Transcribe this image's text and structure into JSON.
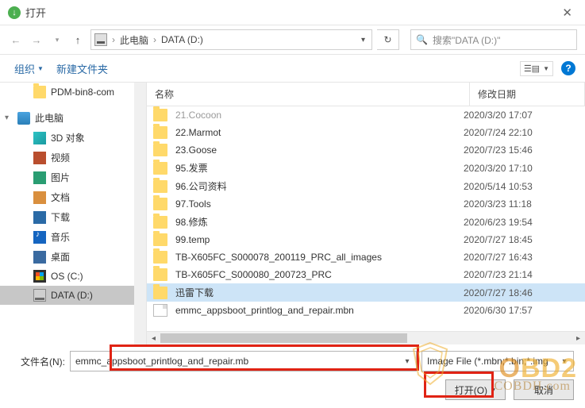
{
  "window": {
    "title": "打开"
  },
  "address": {
    "loc1": "此电脑",
    "loc2": "DATA (D:)"
  },
  "search": {
    "placeholder": "搜索\"DATA (D:)\""
  },
  "cmdbar": {
    "organize": "组织",
    "newfolder": "新建文件夹"
  },
  "tree": [
    {
      "icon": "folder",
      "label": "PDM-bin8-com",
      "indent": 2
    },
    {
      "spacer": true
    },
    {
      "icon": "pc",
      "label": "此电脑",
      "indent": 1,
      "caret": true
    },
    {
      "icon": "cube",
      "label": "3D 对象",
      "indent": 2
    },
    {
      "icon": "video",
      "label": "视频",
      "indent": 2
    },
    {
      "icon": "pic",
      "label": "图片",
      "indent": 2
    },
    {
      "icon": "doc",
      "label": "文档",
      "indent": 2
    },
    {
      "icon": "dl",
      "label": "下载",
      "indent": 2
    },
    {
      "icon": "music",
      "label": "音乐",
      "indent": 2
    },
    {
      "icon": "desk",
      "label": "桌面",
      "indent": 2
    },
    {
      "icon": "win",
      "label": "OS (C:)",
      "indent": 2
    },
    {
      "icon": "disk",
      "label": "DATA (D:)",
      "indent": 2,
      "selected": true
    }
  ],
  "columns": {
    "name": "名称",
    "date": "修改日期"
  },
  "files": [
    {
      "icon": "folder",
      "name": "21.Cocoon",
      "date": "2020/3/20 17:07",
      "faded": true
    },
    {
      "icon": "folder",
      "name": "22.Marmot",
      "date": "2020/7/24 22:10"
    },
    {
      "icon": "folder",
      "name": "23.Goose",
      "date": "2020/7/23 15:46"
    },
    {
      "icon": "folder",
      "name": "95.发票",
      "date": "2020/3/20 17:10"
    },
    {
      "icon": "folder",
      "name": "96.公司资料",
      "date": "2020/5/14 10:53"
    },
    {
      "icon": "folder",
      "name": "97.Tools",
      "date": "2020/3/23 11:18"
    },
    {
      "icon": "folder",
      "name": "98.修炼",
      "date": "2020/6/23 19:54"
    },
    {
      "icon": "folder",
      "name": "99.temp",
      "date": "2020/7/27 18:45"
    },
    {
      "icon": "folder",
      "name": "TB-X605FC_S000078_200119_PRC_all_images",
      "date": "2020/7/27 16:43"
    },
    {
      "icon": "folder",
      "name": "TB-X605FC_S000080_200723_PRC",
      "date": "2020/7/23 21:14"
    },
    {
      "icon": "folder",
      "name": "迅雷下载",
      "date": "2020/7/27 18:46",
      "selected": true
    },
    {
      "icon": "file",
      "name": "emmc_appsboot_printlog_and_repair.mbn",
      "date": "2020/6/30 17:57"
    }
  ],
  "footer": {
    "filename_label": "文件名(N):",
    "filename_value": "emmc_appsboot_printlog_and_repair.mb",
    "filetype_value": "Image File (*.mbn;*.bin;*.img",
    "open": "打开(O)",
    "cancel": "取消"
  },
  "watermark": {
    "brand": "OBD2",
    "site": "COBDH.com"
  }
}
